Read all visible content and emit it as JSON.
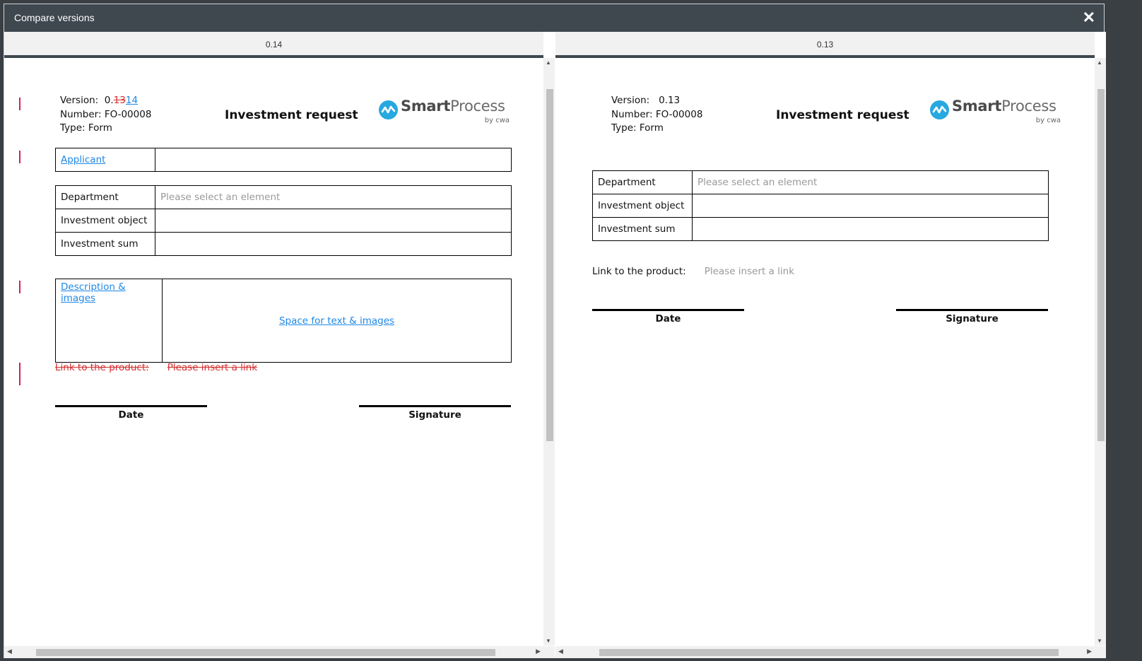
{
  "dialog": {
    "title": "Compare versions"
  },
  "left": {
    "header": "0.14",
    "doc": {
      "version_label": "Version:",
      "version_prefix": "0.",
      "version_deleted": "13",
      "version_inserted": "14",
      "number": "Number: FO-00008",
      "type": "Type: Form",
      "heading": "Investment request",
      "applicant": "Applicant",
      "rows": [
        {
          "label": "Department",
          "value": "Please select an element"
        },
        {
          "label": "Investment object",
          "value": ""
        },
        {
          "label": "Investment sum",
          "value": ""
        }
      ],
      "desc_label": "Description & images",
      "desc_space": "Space for text & images",
      "link_label": "Link to the product:",
      "link_placeholder": "Please insert a link",
      "date": "Date",
      "signature": "Signature"
    }
  },
  "right": {
    "header": "0.13",
    "doc": {
      "version": "Version:   0.13",
      "number": "Number: FO-00008",
      "type": "Type: Form",
      "heading": "Investment request",
      "rows": [
        {
          "label": "Department",
          "value": "Please select an element"
        },
        {
          "label": "Investment object",
          "value": ""
        },
        {
          "label": "Investment sum",
          "value": ""
        }
      ],
      "link_label": "Link to the product:",
      "link_placeholder": "Please insert a link",
      "date": "Date",
      "signature": "Signature"
    }
  },
  "logo": {
    "smart": "Smart",
    "process": "Process",
    "by": "by cwa"
  },
  "colors": {
    "titlebar": "#3f474f",
    "deleted": "#d32f2f",
    "inserted": "#1e88e5",
    "change_marker": "#d81b60",
    "logo_blue": "#27a8e0"
  }
}
